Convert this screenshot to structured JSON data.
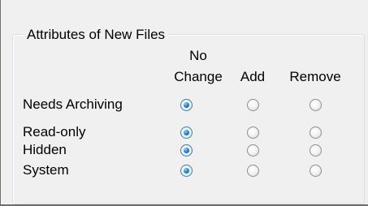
{
  "group": {
    "title": "Attributes of New Files"
  },
  "columns": {
    "no_change_line1": "No",
    "no_change_line2": "Change",
    "add": "Add",
    "remove": "Remove"
  },
  "rows": [
    {
      "label": "Needs Archiving",
      "selected": "no_change"
    },
    {
      "label": "Read-only",
      "selected": "no_change"
    },
    {
      "label": "Hidden",
      "selected": "no_change"
    },
    {
      "label": "System",
      "selected": "no_change"
    }
  ],
  "colors": {
    "dialog_background": "#f0f0f0",
    "groupbox_border": "#d5dfe5",
    "radio_selected": "#2f86d6"
  }
}
